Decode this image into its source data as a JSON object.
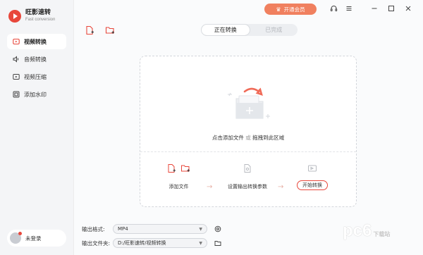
{
  "app": {
    "name": "旺影速转",
    "subtitle": "Fast conversion"
  },
  "sidebar": {
    "items": [
      {
        "label": "视频转换",
        "icon": "video-convert-icon",
        "active": true
      },
      {
        "label": "音频转换",
        "icon": "audio-icon",
        "active": false
      },
      {
        "label": "视频压缩",
        "icon": "compress-icon",
        "active": false
      },
      {
        "label": "添加水印",
        "icon": "watermark-icon",
        "active": false
      }
    ],
    "user_label": "未登录"
  },
  "header": {
    "vip_label": "开通会员",
    "tabs": [
      {
        "label": "正在转换",
        "active": true
      },
      {
        "label": "已完成",
        "active": false
      }
    ]
  },
  "dropzone": {
    "hint_a": "点击添加文件",
    "hint_or": "或",
    "hint_b": "拖拽到此区域",
    "steps": {
      "add": "添加文件",
      "settings": "设置输出转换参数",
      "start": "开始转换"
    }
  },
  "output": {
    "format_label": "输出格式:",
    "format_value": "MP4",
    "folder_label": "输出文件夹:",
    "folder_value": "D:/旺影速转/视频转换"
  },
  "watermark": {
    "big": "pc6",
    "small": "下载站"
  },
  "colors": {
    "accent": "#e8473b",
    "vip": "#f0805f"
  }
}
